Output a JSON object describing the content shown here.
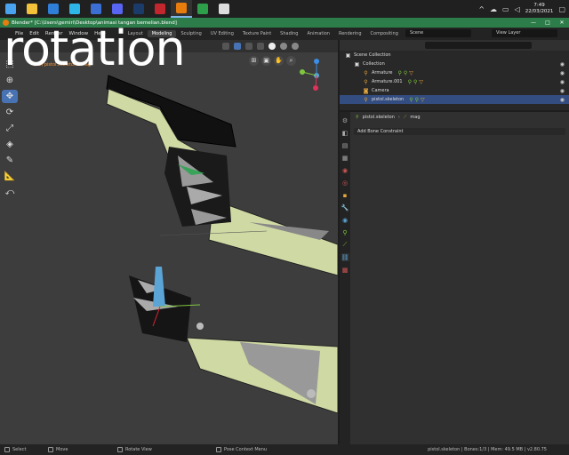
{
  "overlay": {
    "caption": "rotation"
  },
  "taskbar": {
    "apps": [
      {
        "icon": "windows-icon",
        "color": "#4aa3ef"
      },
      {
        "icon": "file-explorer-icon",
        "color": "#f3c13a"
      },
      {
        "icon": "mail-icon",
        "color": "#2f7fd8"
      },
      {
        "icon": "edge-icon",
        "color": "#2fb6e8"
      },
      {
        "icon": "store-icon",
        "color": "#3b6fd4"
      },
      {
        "icon": "discord-icon",
        "color": "#5865f2"
      },
      {
        "icon": "steam-icon",
        "color": "#1b3b6a"
      },
      {
        "icon": "game-app-icon",
        "color": "#c2272d"
      },
      {
        "icon": "blender-icon",
        "color": "#e87d0d"
      },
      {
        "icon": "app-icon",
        "color": "#2d9e4a"
      },
      {
        "icon": "github-icon",
        "color": "#dddddd"
      }
    ],
    "clock": {
      "time": "7:49",
      "date": "22/03/2021"
    }
  },
  "titlebar": {
    "title": "Blender* [C:\\Users\\gemiri\\Desktop\\animasi tangan bemelian.blend]"
  },
  "topbar": {
    "menus": [
      "File",
      "Edit",
      "Render",
      "Window",
      "Help"
    ],
    "workspaces": [
      "Layout",
      "Modeling",
      "Sculpting",
      "UV Editing",
      "Texture Paint",
      "Shading",
      "Animation",
      "Rendering",
      "Compositing"
    ],
    "active_workspace": "Modeling",
    "scene": "Scene",
    "view_layer": "View Layer"
  },
  "viewport": {
    "info_line": "(28) pistol.skeleton : mag",
    "tools": [
      "select-icon",
      "cursor-icon",
      "move-icon",
      "rotate-icon",
      "scale-icon",
      "transform-icon",
      "annotate-icon",
      "measure-icon",
      "roll-icon"
    ],
    "active_tool": "move-icon"
  },
  "outliner": {
    "rows": [
      {
        "label": "Scene Collection",
        "icon": "collection-icon",
        "level": 0,
        "selected": false
      },
      {
        "label": "Collection",
        "icon": "collection-icon",
        "level": 1,
        "selected": false
      },
      {
        "label": "Armature",
        "icon": "armature-icon",
        "level": 2,
        "selected": false
      },
      {
        "label": "Armature.001",
        "icon": "armature-icon",
        "level": 2,
        "selected": false
      },
      {
        "label": "Camera",
        "icon": "camera-icon",
        "level": 2,
        "selected": false
      },
      {
        "label": "pistol.skeleton",
        "icon": "armature-icon",
        "level": 2,
        "selected": true
      }
    ]
  },
  "properties": {
    "object": "pistol.skeleton",
    "bone": "mag",
    "add_constraint": "Add Bone Constraint"
  },
  "statusbar": {
    "select": "Select",
    "move": "Move",
    "rotate": "Rotate View",
    "context": "Pose Context Menu",
    "stats": "pistol.skeleton | Bones:1/3 | Mem: 49.5 MB | v2.80.75"
  }
}
